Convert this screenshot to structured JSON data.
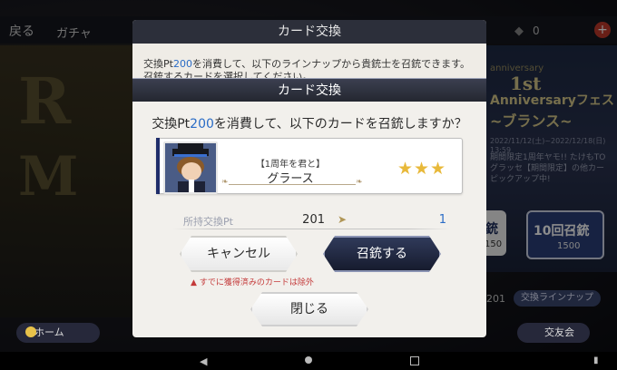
{
  "top_bar": {
    "back": "戻る",
    "gacha": "ガチャ",
    "currency": "0",
    "plus": "+"
  },
  "bg_panel": {
    "title": "カード交換",
    "text_prefix": "交換Pt",
    "text_points": "200",
    "text_line1_suffix": "を消費して、以下のラインナップから貴銃士を召銃できます。",
    "text_line2": "召銃するカードを選択してください。"
  },
  "event": {
    "line1": "anniversary",
    "line2": "1st",
    "line3": "Anniversaryフェス",
    "line4": "~ブランス~",
    "date": "2022/11/12(土)~2022/12/18(日) 13:59",
    "body": "期間限定1周年ヤモ!! たけもTO\nグラッセ【期間限定】の他カー\nピックアップ中!"
  },
  "summon_buttons": {
    "one_label": "銃",
    "one_cost": "150",
    "ten_label": "10回召銃",
    "ten_cost": "1500"
  },
  "lineup": {
    "count": "201",
    "label": "交換ラインナップ"
  },
  "bottom_menu": {
    "home": "ホーム",
    "friend": "交友会"
  },
  "dialog": {
    "title": "カード交換",
    "msg_prefix": "交換Pt",
    "msg_points": "200",
    "msg_suffix": "を消費して、以下のカードを召銃しますか？",
    "card": {
      "title": "【1周年を君と】",
      "name": "グラース",
      "rarity": 3
    },
    "exchange": {
      "label": "所持交換Pt",
      "before": "201",
      "after": "1"
    },
    "cancel": "キャンセル",
    "summon": "召銃する",
    "warning": "すでに獲得済みのカードは除外",
    "close": "閉じる"
  },
  "colors": {
    "accent_blue": "#2a6cc6",
    "star_gold": "#e8b93a",
    "dialog_bg": "#f2f0ec",
    "dark_button": "#1e2438"
  }
}
